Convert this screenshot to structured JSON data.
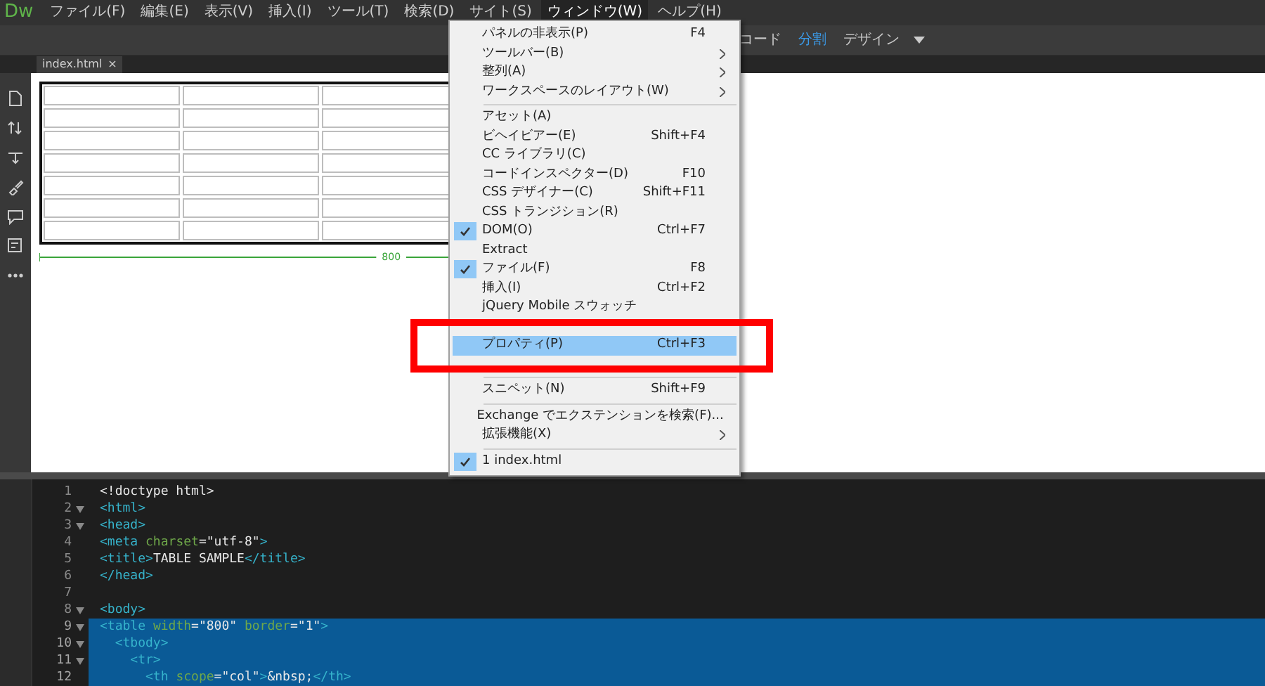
{
  "app": {
    "logo": "Dw"
  },
  "menubar": [
    {
      "label": "ファイル(F)",
      "open": false
    },
    {
      "label": "編集(E)",
      "open": false
    },
    {
      "label": "表示(V)",
      "open": false
    },
    {
      "label": "挿入(I)",
      "open": false
    },
    {
      "label": "ツール(T)",
      "open": false
    },
    {
      "label": "検索(D)",
      "open": false
    },
    {
      "label": "サイト(S)",
      "open": false
    },
    {
      "label": "ウィンドウ(W)",
      "open": true
    },
    {
      "label": "ヘルプ(H)",
      "open": false
    }
  ],
  "view_modes": [
    {
      "label": "コード",
      "selected": false
    },
    {
      "label": "分割",
      "selected": true
    },
    {
      "label": "デザイン",
      "selected": false
    }
  ],
  "document_tab": {
    "label": "index.html",
    "close": "×"
  },
  "design_view": {
    "width_label": "800"
  },
  "code_lines": [
    {
      "number": "1",
      "foldable": false,
      "selected": false,
      "tokens": [
        {
          "kind": "text",
          "text": "<!doctype html>"
        }
      ]
    },
    {
      "number": "2",
      "foldable": true,
      "selected": false,
      "tokens": [
        {
          "kind": "tag",
          "text": "<html>"
        }
      ]
    },
    {
      "number": "3",
      "foldable": true,
      "selected": false,
      "tokens": [
        {
          "kind": "tag",
          "text": "<head>"
        }
      ]
    },
    {
      "number": "4",
      "foldable": false,
      "selected": false,
      "tokens": [
        {
          "kind": "tag",
          "text": "<meta "
        },
        {
          "kind": "attr",
          "text": "charset"
        },
        {
          "kind": "text",
          "text": "=\"utf-8\""
        },
        {
          "kind": "tag",
          "text": ">"
        }
      ]
    },
    {
      "number": "5",
      "foldable": false,
      "selected": false,
      "tokens": [
        {
          "kind": "tag",
          "text": "<title>"
        },
        {
          "kind": "text",
          "text": "TABLE SAMPLE"
        },
        {
          "kind": "tag",
          "text": "</title>"
        }
      ]
    },
    {
      "number": "6",
      "foldable": false,
      "selected": false,
      "tokens": [
        {
          "kind": "tag",
          "text": "</head>"
        }
      ]
    },
    {
      "number": "7",
      "foldable": false,
      "selected": false
    },
    {
      "number": "8",
      "foldable": true,
      "selected": false,
      "tokens": [
        {
          "kind": "tag",
          "text": "<body>"
        }
      ]
    },
    {
      "number": "9",
      "foldable": true,
      "selected": true,
      "tokens": [
        {
          "kind": "tag",
          "text": "<table "
        },
        {
          "kind": "attr",
          "text": "width"
        },
        {
          "kind": "text",
          "text": "=\"800\" "
        },
        {
          "kind": "attr",
          "text": "border"
        },
        {
          "kind": "text",
          "text": "=\"1\""
        },
        {
          "kind": "tag",
          "text": ">"
        }
      ]
    },
    {
      "number": "10",
      "foldable": true,
      "selected": true,
      "tokens": [
        {
          "kind": "tag",
          "text": "  <tbody>"
        }
      ]
    },
    {
      "number": "11",
      "foldable": true,
      "selected": true,
      "tokens": [
        {
          "kind": "tag",
          "text": "    <tr>"
        }
      ]
    },
    {
      "number": "12",
      "foldable": false,
      "selected": true,
      "tokens": [
        {
          "kind": "tag",
          "text": "      <th "
        },
        {
          "kind": "attr",
          "text": "scope"
        },
        {
          "kind": "text",
          "text": "=\"col\""
        },
        {
          "kind": "tag",
          "text": ">"
        },
        {
          "kind": "text",
          "text": "&nbsp;"
        },
        {
          "kind": "tag",
          "text": "</th>"
        }
      ]
    }
  ],
  "window_menu": [
    {
      "kind": "item",
      "label": "パネルの非表示(P)",
      "shortcut": "F4",
      "submenu": false,
      "checked": false,
      "selected": false
    },
    {
      "kind": "item",
      "label": "ツールバー(B)",
      "submenu": true,
      "checked": false,
      "selected": false
    },
    {
      "kind": "item",
      "label": "整列(A)",
      "submenu": true,
      "checked": false,
      "selected": false
    },
    {
      "kind": "item",
      "label": "ワークスペースのレイアウト(W)",
      "submenu": true,
      "checked": false,
      "selected": false
    },
    {
      "kind": "separator"
    },
    {
      "kind": "item",
      "label": "アセット(A)",
      "submenu": false,
      "checked": false,
      "selected": false
    },
    {
      "kind": "item",
      "label": "ビヘイビアー(E)",
      "shortcut": "Shift+F4",
      "submenu": false,
      "checked": false,
      "selected": false
    },
    {
      "kind": "item",
      "label": "CC ライブラリ(C)",
      "submenu": false,
      "checked": false,
      "selected": false
    },
    {
      "kind": "item",
      "label": "コードインスペクター(D)",
      "shortcut": "F10",
      "submenu": false,
      "checked": false,
      "selected": false
    },
    {
      "kind": "item",
      "label": "CSS デザイナー(C)",
      "shortcut": "Shift+F11",
      "submenu": false,
      "checked": false,
      "selected": false
    },
    {
      "kind": "item",
      "label": "CSS トランジション(R)",
      "submenu": false,
      "checked": false,
      "selected": false
    },
    {
      "kind": "item",
      "label": "DOM(O)",
      "shortcut": "Ctrl+F7",
      "submenu": false,
      "checked": true,
      "selected": false
    },
    {
      "kind": "item",
      "label": "Extract",
      "submenu": false,
      "checked": false,
      "selected": false
    },
    {
      "kind": "item",
      "label": "ファイル(F)",
      "shortcut": "F8",
      "submenu": false,
      "checked": true,
      "selected": false
    },
    {
      "kind": "item",
      "label": "挿入(I)",
      "shortcut": "Ctrl+F2",
      "submenu": false,
      "checked": false,
      "selected": false
    },
    {
      "kind": "item",
      "label": "jQuery Mobile スウォッチ",
      "submenu": false,
      "checked": false,
      "selected": false
    },
    {
      "kind": "obscured"
    },
    {
      "kind": "item",
      "label": "プロパティ(P)",
      "shortcut": "Ctrl+F3",
      "submenu": false,
      "checked": false,
      "selected": true,
      "callout": true
    },
    {
      "kind": "obscured"
    },
    {
      "kind": "separator"
    },
    {
      "kind": "item",
      "label": "スニペット(N)",
      "shortcut": "Shift+F9",
      "submenu": false,
      "checked": false,
      "selected": false
    },
    {
      "kind": "separator"
    },
    {
      "kind": "item",
      "label": "Exchange でエクステンションを検索(F)...",
      "submenu": false,
      "checked": false,
      "selected": false
    },
    {
      "kind": "item",
      "label": "拡張機能(X)",
      "submenu": true,
      "checked": false,
      "selected": false
    },
    {
      "kind": "separator"
    },
    {
      "kind": "item",
      "label": "1 index.html",
      "submenu": false,
      "checked": true,
      "selected": false
    }
  ]
}
